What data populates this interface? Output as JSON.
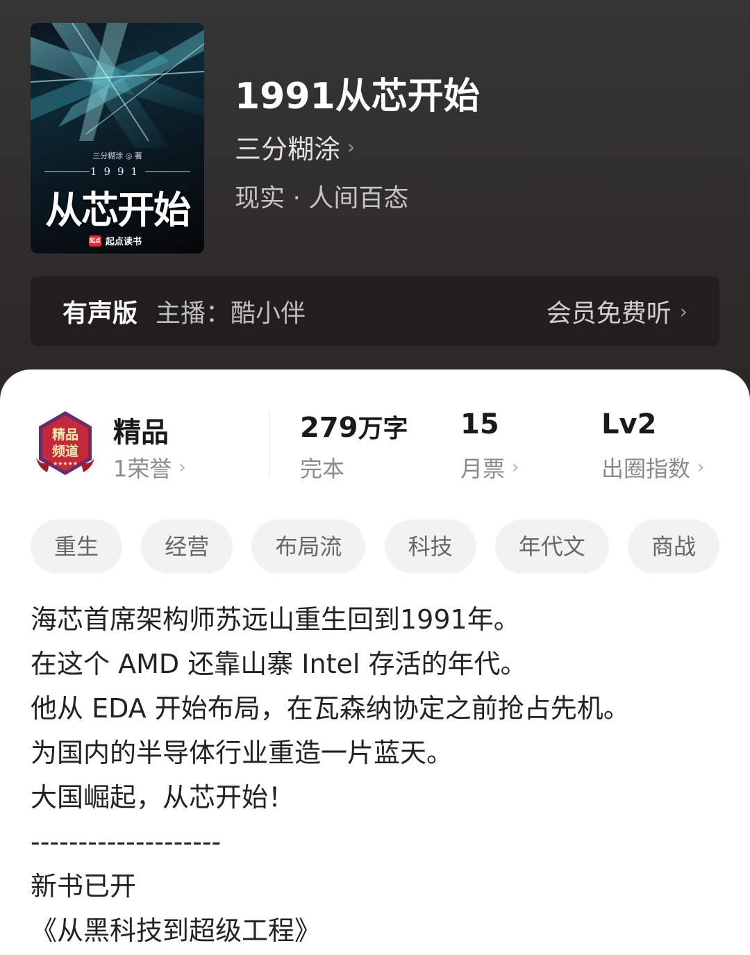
{
  "book": {
    "title": "1991从芯开始",
    "author": "三分糊涂",
    "genre": "现实 · 人间百态"
  },
  "cover": {
    "author_line": "三分糊涂 ◎ 著",
    "year": "1991",
    "title": "从芯开始",
    "publisher_logo": "起点",
    "publisher": "起点读书"
  },
  "audio": {
    "label": "有声版",
    "host": "主播：酷小伴",
    "action": "会员免费听"
  },
  "stats": {
    "quality": {
      "title": "精品",
      "sub": "1荣誉"
    },
    "words": {
      "value": "279",
      "unit": "万字",
      "sub": "完本"
    },
    "monthly": {
      "value": "15",
      "sub": "月票"
    },
    "level": {
      "value": "Lv2",
      "sub": "出圈指数"
    }
  },
  "badge": {
    "line1": "精品",
    "line2": "频道"
  },
  "tags": [
    "重生",
    "经营",
    "布局流",
    "科技",
    "年代文",
    "商战"
  ],
  "description": [
    "海芯首席架构师苏远山重生回到1991年。",
    "在这个 AMD 还靠山寨 Intel 存活的年代。",
    "他从 EDA 开始布局，在瓦森纳协定之前抢占先机。",
    "为国内的半导体行业重造一片蓝天。",
    "大国崛起，从芯开始！",
    "--------------------",
    "新书已开",
    "《从黑科技到超级工程》"
  ],
  "colors": {
    "accent_red": "#e8262e",
    "badge_purple": "#6b2c6e"
  }
}
